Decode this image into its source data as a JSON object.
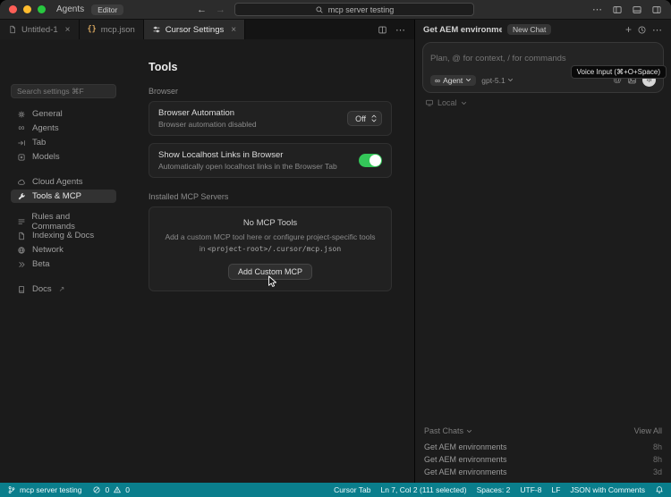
{
  "titlebar": {
    "app_label": "Agents",
    "mode_badge": "Editor",
    "back": "←",
    "forward": "→",
    "search_value": "mcp server testing"
  },
  "tabbar": {
    "tabs": [
      {
        "label": "Untitled-1",
        "icon": "file"
      },
      {
        "label": "mcp.json",
        "icon": "json-braces"
      },
      {
        "label": "Cursor Settings",
        "icon": "settings-sliders",
        "active": true
      }
    ],
    "json_braces_glyph": "{}"
  },
  "settings": {
    "search_placeholder": "Search settings ⌘F",
    "nav": [
      {
        "label": "General",
        "icon": "gear"
      },
      {
        "label": "Agents",
        "icon": "infinity"
      },
      {
        "label": "Tab",
        "icon": "tab-arrow"
      },
      {
        "label": "Models",
        "icon": "box"
      },
      {
        "label": "Cloud Agents",
        "icon": "cloud"
      },
      {
        "label": "Tools & MCP",
        "icon": "wrench",
        "selected": true
      },
      {
        "label": "Rules and Commands",
        "icon": "list"
      },
      {
        "label": "Indexing & Docs",
        "icon": "file"
      },
      {
        "label": "Network",
        "icon": "globe"
      },
      {
        "label": "Beta",
        "icon": "chevrons-right"
      },
      {
        "label": "Docs",
        "icon": "book",
        "external": "↗"
      }
    ],
    "page_title": "Tools",
    "browser": {
      "title": "Browser",
      "automation_title": "Browser Automation",
      "automation_sub": "Browser automation disabled",
      "automation_value": "Off",
      "localhost_title": "Show Localhost Links in Browser",
      "localhost_sub": "Automatically open localhost links in the Browser Tab"
    },
    "mcp": {
      "title": "Installed MCP Servers",
      "empty_title": "No MCP Tools",
      "empty_desc": "Add a custom MCP tool here or configure project-specific tools in ",
      "empty_code": "<project-root>/.cursor/mcp.json",
      "add_button": "Add Custom MCP"
    }
  },
  "chat": {
    "header_title": "Get AEM environments",
    "new_chat_badge": "New Chat",
    "input_placeholder": "Plan, @ for context, / for commands",
    "agent_label": "Agent",
    "agent_glyph": "∞",
    "model_label": "gpt-5.1",
    "voice_tooltip": "Voice Input (⌘+O+Space)",
    "scope_label": "Local",
    "past_chats": {
      "title": "Past Chats",
      "view_all": "View All",
      "items": [
        {
          "title": "Get AEM environments",
          "time": "8h"
        },
        {
          "title": "Get AEM environments",
          "time": "8h"
        },
        {
          "title": "Get AEM environments",
          "time": "3d"
        }
      ]
    }
  },
  "statusbar": {
    "branch": "mcp server testing",
    "errors": "0",
    "warnings": "0",
    "items": [
      "Cursor Tab",
      "Ln 7, Col 2 (111 selected)",
      "Spaces: 2",
      "UTF-8",
      "LF",
      "JSON with Comments"
    ]
  },
  "colors": {
    "toggle_on": "#34c759",
    "statusbar_bg": "#0a7e8c",
    "json_braces": "#d7a65f",
    "traffic_red": "#ff5f57",
    "traffic_yellow": "#febc2e",
    "traffic_green": "#28c840"
  }
}
